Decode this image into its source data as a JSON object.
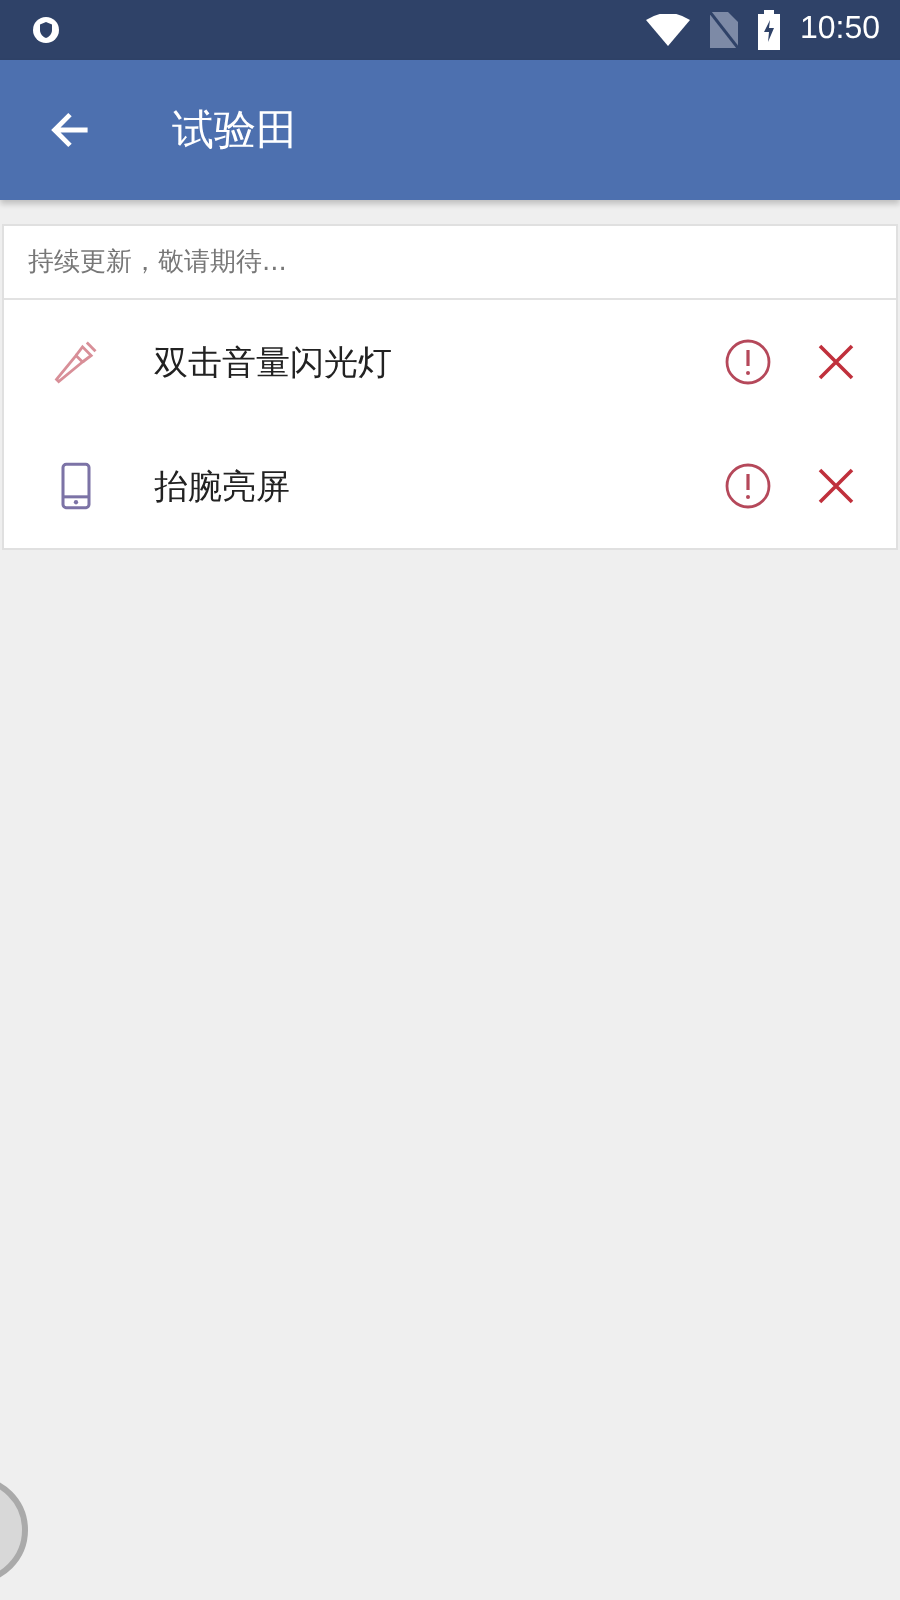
{
  "status_bar": {
    "time": "10:50"
  },
  "app_bar": {
    "title": "试验田"
  },
  "card": {
    "note": "持续更新，敬请期待...",
    "items": [
      {
        "kind": "flashlight",
        "label": "双击音量闪光灯"
      },
      {
        "kind": "phone",
        "label": "抬腕亮屏"
      }
    ]
  }
}
